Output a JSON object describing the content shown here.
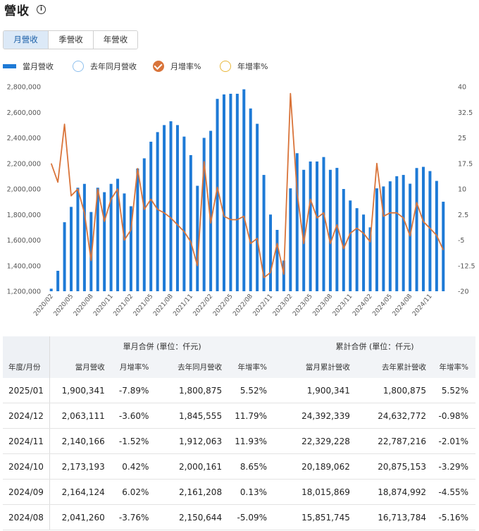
{
  "header": {
    "title": "營收",
    "info_icon": "info-icon"
  },
  "tabs": [
    {
      "label": "月營收",
      "active": true
    },
    {
      "label": "季營收",
      "active": false
    },
    {
      "label": "年營收",
      "active": false
    }
  ],
  "legend": {
    "monthly": "當月營收",
    "last_year": "去年同月營收",
    "mom": "月增率%",
    "yoy": "年增率%"
  },
  "colors": {
    "bar": "#1e7ad6",
    "line": "#d9743a",
    "last_year": "#1e7ad6",
    "yoy": "#e8b73a",
    "tab_active": "#dce9f7"
  },
  "chart_data": {
    "type": "bar",
    "x_tick_labels": [
      "2020/02",
      "2020/05",
      "2020/08",
      "2020/11",
      "2021/02",
      "2021/05",
      "2021/08",
      "2021/11",
      "2022/02",
      "2022/05",
      "2022/08",
      "2022/11",
      "2023/02",
      "2023/05",
      "2023/08",
      "2023/11",
      "2024/02",
      "2024/05",
      "2024/08",
      "2024/11"
    ],
    "start_month": "2020/02",
    "series": [
      {
        "name": "當月營收",
        "axis": "left",
        "type": "bar",
        "values": [
          1220000,
          1360000,
          1740000,
          1860000,
          2010000,
          2040000,
          1820000,
          2010000,
          1975000,
          2040000,
          2080000,
          1965000,
          1865000,
          2160000,
          2240000,
          2370000,
          2445000,
          2500000,
          2530000,
          2500000,
          2410000,
          2265000,
          2025000,
          2400000,
          2455000,
          2705000,
          2740000,
          2745000,
          2745000,
          2780000,
          2630000,
          2510000,
          2110000,
          1800000,
          1680000,
          1440000,
          2005000,
          2280000,
          2150000,
          2215000,
          2215000,
          2250000,
          2150000,
          2165000,
          2000000,
          1910000,
          1850000,
          1800000,
          1700000,
          2005000,
          2020000,
          2060000,
          2100000,
          2110000,
          2041260,
          2164124,
          2173193,
          2140166,
          2063111,
          1900341
        ]
      },
      {
        "name": "月增率%",
        "axis": "right",
        "type": "line",
        "values": [
          17.5,
          12,
          29,
          8,
          10,
          3,
          -11,
          10,
          0.5,
          7,
          10,
          -5,
          -2,
          16,
          4,
          7,
          4,
          3,
          1.5,
          -0.5,
          -2.5,
          -5.5,
          -12.5,
          18,
          0,
          10.5,
          2,
          1,
          1,
          2,
          -6,
          -4.5,
          -16,
          -14.5,
          -6,
          -15,
          38,
          9,
          -6,
          7,
          1.5,
          3,
          -6,
          -0.5,
          -7.5,
          -3,
          -1.5,
          -3,
          -5.5,
          17.5,
          2,
          3,
          3,
          1.5,
          -3.76,
          6.02,
          0.42,
          -1.52,
          -3.6,
          -7.89
        ]
      }
    ],
    "y_left": {
      "min": 1200000,
      "max": 2800000,
      "ticks": [
        "1,200,000",
        "1,400,000",
        "1,600,000",
        "1,800,000",
        "2,000,000",
        "2,200,000",
        "2,400,000",
        "2,600,000",
        "2,800,000"
      ]
    },
    "y_right": {
      "min": -20,
      "max": 40,
      "ticks": [
        "-20",
        "-12.5",
        "-5",
        "2.5",
        "10",
        "17.5",
        "25",
        "32.5",
        "40"
      ]
    },
    "grid": false,
    "legend_position": "top-left"
  },
  "table": {
    "group_monthly": "單月合併 (單位：仟元)",
    "group_cumulative": "累計合併 (單位：仟元)",
    "headers": [
      "年度/月份",
      "當月營收",
      "月增率%",
      "去年同月營收",
      "年增率%",
      "當月累計營收",
      "去年累計營收",
      "年增率%"
    ],
    "rows": [
      [
        "2025/01",
        "1,900,341",
        "-7.89%",
        "1,800,875",
        "5.52%",
        "1,900,341",
        "1,800,875",
        "5.52%"
      ],
      [
        "2024/12",
        "2,063,111",
        "-3.60%",
        "1,845,555",
        "11.79%",
        "24,392,339",
        "24,632,772",
        "-0.98%"
      ],
      [
        "2024/11",
        "2,140,166",
        "-1.52%",
        "1,912,063",
        "11.93%",
        "22,329,228",
        "22,787,216",
        "-2.01%"
      ],
      [
        "2024/10",
        "2,173,193",
        "0.42%",
        "2,000,161",
        "8.65%",
        "20,189,062",
        "20,875,153",
        "-3.29%"
      ],
      [
        "2024/09",
        "2,164,124",
        "6.02%",
        "2,161,208",
        "0.13%",
        "18,015,869",
        "18,874,992",
        "-4.55%"
      ],
      [
        "2024/08",
        "2,041,260",
        "-3.76%",
        "2,150,644",
        "-5.09%",
        "15,851,745",
        "16,713,784",
        "-5.16%"
      ]
    ]
  }
}
